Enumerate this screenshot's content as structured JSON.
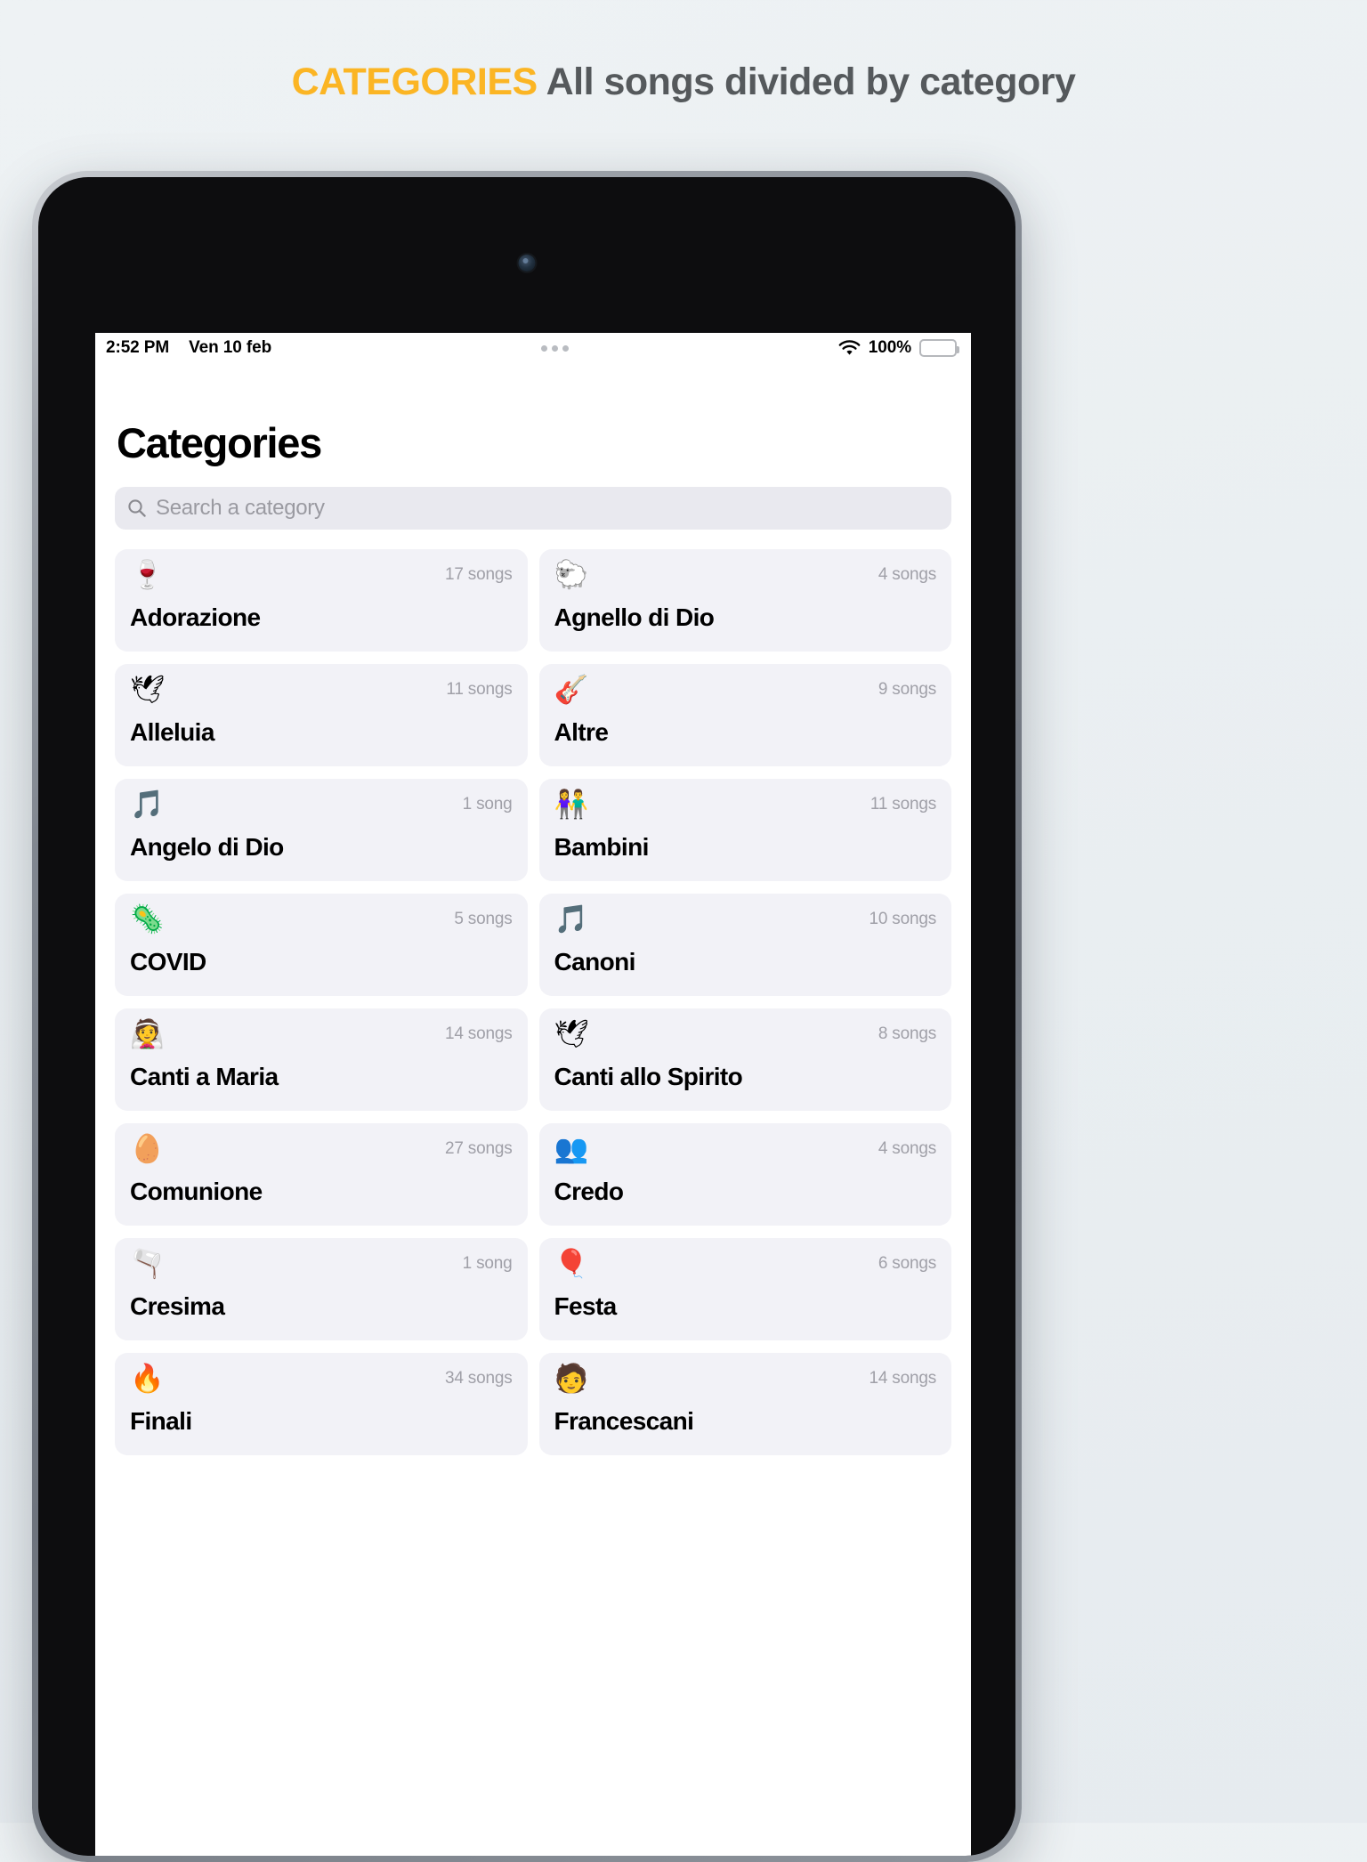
{
  "marketing": {
    "accent_word": "CATEGORIES",
    "rest_text": " All songs divided by category",
    "accent_color": "#fbb524",
    "text_color": "#55595c"
  },
  "statusbar": {
    "time": "2:52 PM",
    "date": "Ven 10 feb",
    "wifi_icon": "wifi-icon",
    "battery_percent": "100%",
    "battery_icon": "battery-full-icon"
  },
  "page": {
    "title": "Categories"
  },
  "search": {
    "icon": "search-icon",
    "placeholder": "Search a category",
    "value": ""
  },
  "categories": [
    {
      "name": "Adorazione",
      "count": "17 songs",
      "icon": "🍷",
      "icon_name": "chalice-icon"
    },
    {
      "name": "Agnello di Dio",
      "count": "4 songs",
      "icon": "🐑",
      "icon_name": "lamb-icon"
    },
    {
      "name": "Alleluia",
      "count": "11 songs",
      "icon": "🕊",
      "icon_name": "dove-icon"
    },
    {
      "name": "Altre",
      "count": "9 songs",
      "icon": "🎸",
      "icon_name": "guitar-icon"
    },
    {
      "name": "Angelo di Dio",
      "count": "1 song",
      "icon": "🎵",
      "icon_name": "music-notes-icon"
    },
    {
      "name": "Bambini",
      "count": "11 songs",
      "icon": "👫",
      "icon_name": "children-icon"
    },
    {
      "name": "COVID",
      "count": "5 songs",
      "icon": "🦠",
      "icon_name": "virus-icon"
    },
    {
      "name": "Canoni",
      "count": "10 songs",
      "icon": "🎵",
      "icon_name": "music-notes-icon"
    },
    {
      "name": "Canti a Maria",
      "count": "14 songs",
      "icon": "👰",
      "icon_name": "madonna-icon"
    },
    {
      "name": "Canti allo Spirito",
      "count": "8 songs",
      "icon": "🕊",
      "icon_name": "holy-spirit-dove-icon"
    },
    {
      "name": "Comunione",
      "count": "27 songs",
      "icon": "🥚",
      "icon_name": "bread-hand-icon"
    },
    {
      "name": "Credo",
      "count": "4 songs",
      "icon": "👥",
      "icon_name": "people-group-icon"
    },
    {
      "name": "Cresima",
      "count": "1 song",
      "icon": "🫗",
      "icon_name": "anointing-oil-icon"
    },
    {
      "name": "Festa",
      "count": "6 songs",
      "icon": "🎈",
      "icon_name": "balloons-icon"
    },
    {
      "name": "Finali",
      "count": "34 songs",
      "icon": "🔥",
      "icon_name": "flame-icon"
    },
    {
      "name": "Francescani",
      "count": "14 songs",
      "icon": "🧑",
      "icon_name": "friar-icon"
    }
  ]
}
